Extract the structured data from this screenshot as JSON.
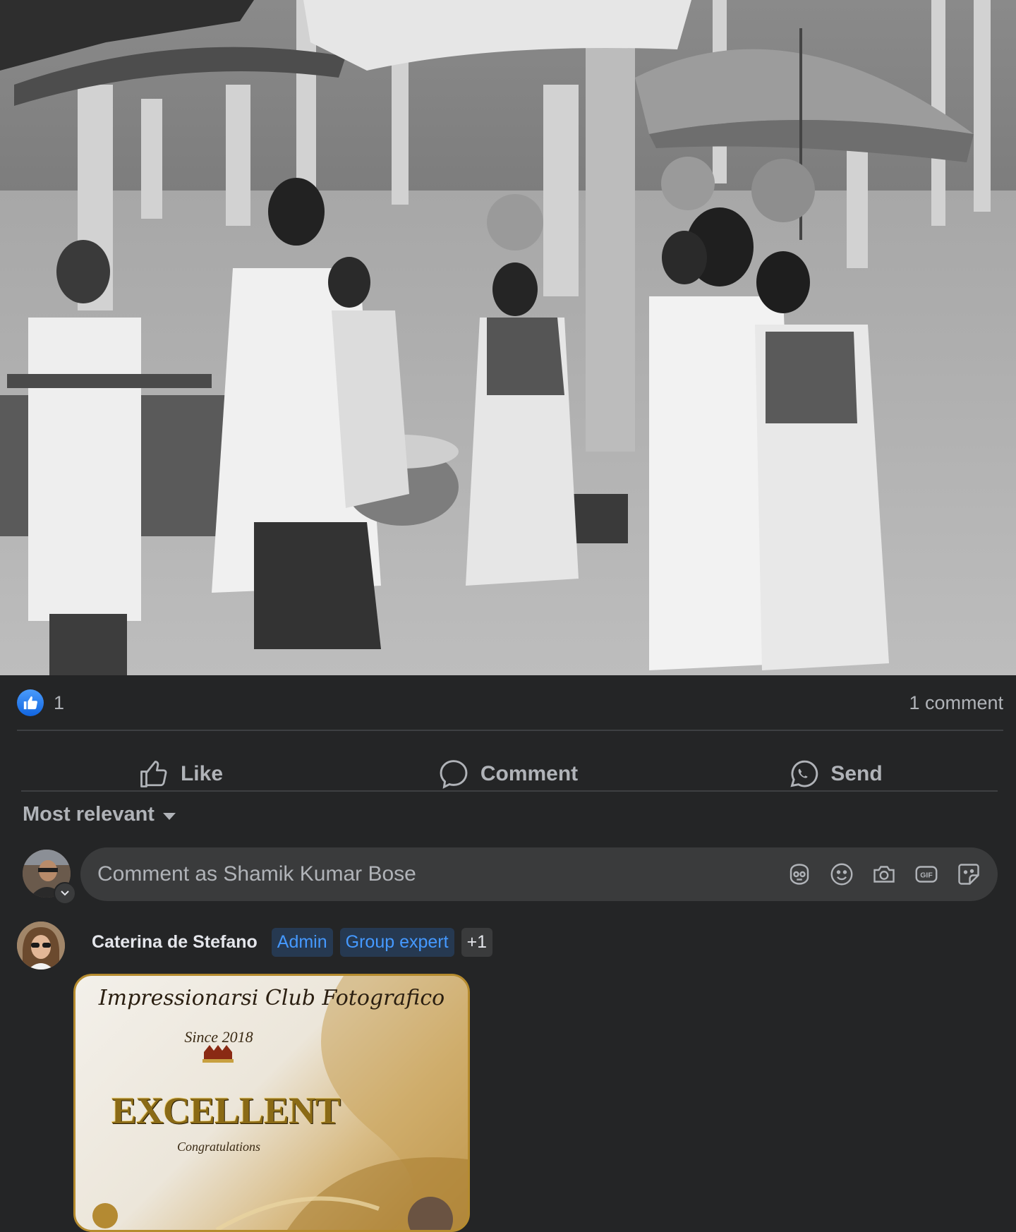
{
  "reactions": {
    "count": "1",
    "comments_label": "1 comment"
  },
  "actions": {
    "like": "Like",
    "comment": "Comment",
    "send": "Send"
  },
  "sort": {
    "label": "Most relevant"
  },
  "composer": {
    "placeholder": "Comment as Shamik Kumar Bose",
    "icons": [
      "avatar-sticker-icon",
      "emoji-icon",
      "camera-icon",
      "gif-icon",
      "sticker-icon"
    ]
  },
  "comment": {
    "author": "Caterina de Stefano",
    "badges": [
      "Admin",
      "Group expert"
    ],
    "more_badges": "+1",
    "award": {
      "title": "Impressionarsi Club Fotografico",
      "since": "Since 2018",
      "rating": "EXCELLENT",
      "congrats": "Congratulations"
    }
  },
  "colors": {
    "background": "#242526",
    "surface": "#3a3b3c",
    "like_blue": "#1877f2",
    "badge_text": "#4599ff"
  }
}
